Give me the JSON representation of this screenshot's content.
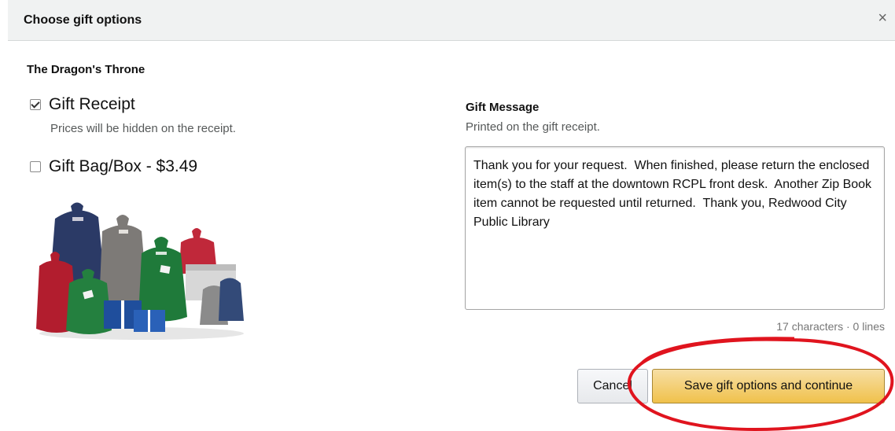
{
  "dialog": {
    "title": "Choose gift options",
    "close_label": "×"
  },
  "product": {
    "title": "The Dragon's Throne"
  },
  "options": {
    "gift_receipt": {
      "label": "Gift Receipt",
      "checked": true,
      "description": "Prices will be hidden on the receipt."
    },
    "gift_bag": {
      "label": "Gift Bag/Box - $3.49",
      "checked": false
    }
  },
  "gift_message": {
    "title": "Gift Message",
    "subtitle": "Printed on the gift receipt.",
    "text": "Thank you for your request.  When finished, please return the enclosed item(s) to the staff at the downtown RCPL front desk.  Another Zip Book item cannot be requested until returned.  Thank you, Redwood City Public Library",
    "counter": "17 characters · 0 lines"
  },
  "buttons": {
    "cancel": "Cancel",
    "save": "Save gift options and continue"
  },
  "colors": {
    "save_button": "#f0c14b",
    "annotation_circle": "#e0141e"
  },
  "icons": [
    "close-icon",
    "checkbox-checked-icon",
    "checkbox-unchecked-icon"
  ]
}
